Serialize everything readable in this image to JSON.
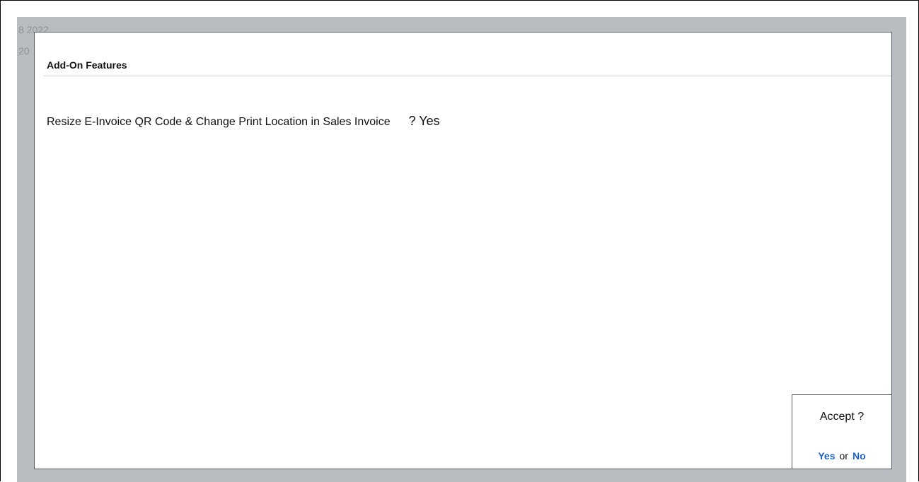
{
  "background": {
    "date_fragment_1": "8 2022",
    "date_fragment_2": "20"
  },
  "panel": {
    "title": "Add-On Features",
    "features": [
      {
        "label": "Resize E-Invoice QR Code & Change Print Location in Sales Invoice",
        "value": "? Yes"
      }
    ]
  },
  "accept_dialog": {
    "question": "Accept ?",
    "yes_label": "Yes",
    "or_label": "or",
    "no_label": "No"
  },
  "colors": {
    "background_gray": "#b9bdc1",
    "option_blue": "#1f63c1"
  }
}
